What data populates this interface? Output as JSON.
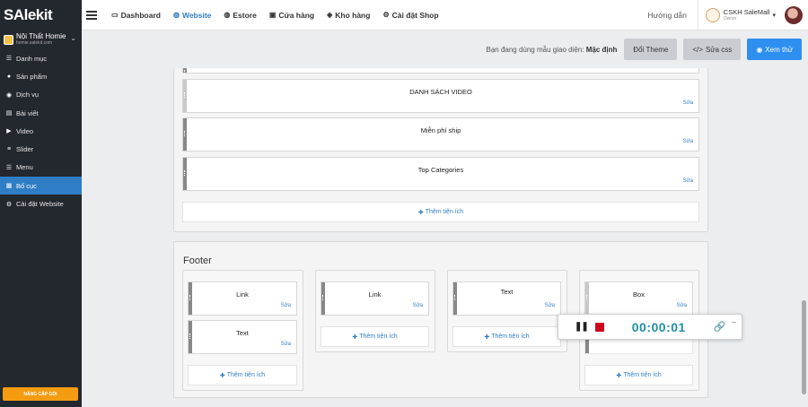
{
  "app": {
    "logo": "SAlekit"
  },
  "shop": {
    "name": "Nội Thất Homie",
    "url": "homie.salekit.com"
  },
  "sidebar": {
    "items": [
      {
        "label": "Danh mục",
        "icon": "list-icon"
      },
      {
        "label": "Sản phẩm",
        "icon": "cube-icon"
      },
      {
        "label": "Dịch vụ",
        "icon": "globe-icon"
      },
      {
        "label": "Bài viết",
        "icon": "newspaper-icon"
      },
      {
        "label": "Video",
        "icon": "play-icon"
      },
      {
        "label": "Slider",
        "icon": "sliders-icon"
      },
      {
        "label": "Menu",
        "icon": "menu-icon"
      },
      {
        "label": "Bố cục",
        "icon": "layout-icon"
      },
      {
        "label": "Cài đặt Website",
        "icon": "gear-icon"
      }
    ],
    "upgrade_label": "NÂNG CẤP GÓI"
  },
  "topnav": {
    "items": [
      {
        "label": "Dashboard",
        "icon": "monitor-icon"
      },
      {
        "label": "Website",
        "icon": "globe-icon"
      },
      {
        "label": "Estore",
        "icon": "globe-icon"
      },
      {
        "label": "Cửa hàng",
        "icon": "store-icon"
      },
      {
        "label": "Kho hàng",
        "icon": "stack-icon"
      },
      {
        "label": "Cài đặt Shop",
        "icon": "gear-icon"
      }
    ],
    "help_label": "Hướng dẫn",
    "user_name": "CSKH SaleMall",
    "user_role": "Owner"
  },
  "themebar": {
    "prefix": "Bạn đang dùng mẫu giao diện:",
    "theme_name": "Mặc định",
    "change_theme_label": "Đổi Theme",
    "edit_css_label": "Sửa css",
    "preview_label": "Xem thử"
  },
  "body_section": {
    "widgets": [
      {
        "title": "DANH SÁCH VIDEO",
        "edit": "Sửa"
      },
      {
        "title": "Miễn phí ship",
        "edit": "Sửa"
      },
      {
        "title": "Top Categories",
        "edit": "Sửa"
      }
    ],
    "add_label": "Thêm tiện ích"
  },
  "footer": {
    "title": "Footer",
    "columns": [
      {
        "widgets": [
          {
            "title": "Link",
            "edit": "Sửa"
          },
          {
            "title": "Text",
            "edit": "Sửa"
          }
        ],
        "add_label": "Thêm tiện ích"
      },
      {
        "widgets": [
          {
            "title": "Link",
            "edit": "Sửa"
          }
        ],
        "add_label": "Thêm tiện ích"
      },
      {
        "widgets": [
          {
            "title": "Text",
            "edit": "Sửa"
          }
        ],
        "add_label": "Thêm tiện ích"
      },
      {
        "widgets": [
          {
            "title": "Box",
            "edit": "Sửa"
          }
        ],
        "add_label": "Thêm tiện ích"
      }
    ]
  },
  "recorder": {
    "time": "00:00:01"
  }
}
